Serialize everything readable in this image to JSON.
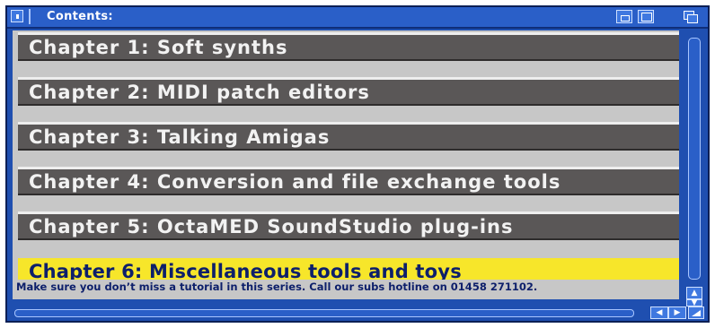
{
  "window": {
    "title": "Contents:"
  },
  "chapters": [
    {
      "label": "Chapter 1: Soft synths"
    },
    {
      "label": "Chapter 2: MIDI patch editors"
    },
    {
      "label": "Chapter 3: Talking Amigas"
    },
    {
      "label": "Chapter 4: Conversion and file exchange tools"
    },
    {
      "label": "Chapter 5: OctaMED SoundStudio plug-ins"
    },
    {
      "label": "Chapter 6: Miscellaneous tools and toys"
    }
  ],
  "selected_chapter": "Chapter 6: Miscellaneous tools and toys",
  "status": {
    "text": "Make sure you don’t miss a tutorial in this series. Call our subs hotline on 01458 271102."
  },
  "colors": {
    "window_blue": "#1f4fb0",
    "chapter_gray": "#5a5757",
    "highlight_yellow": "#f7e62a",
    "text_navy": "#0d1f6b"
  },
  "icons": {
    "close": "close-gadget-icon",
    "iconify": "iconify-icon",
    "zoom": "zoom-icon",
    "depth": "depth-icon",
    "scroll_up": "arrow-up-icon",
    "scroll_down": "arrow-down-icon",
    "scroll_left": "arrow-left-icon",
    "scroll_right": "arrow-right-icon",
    "sizing": "resize-icon"
  }
}
